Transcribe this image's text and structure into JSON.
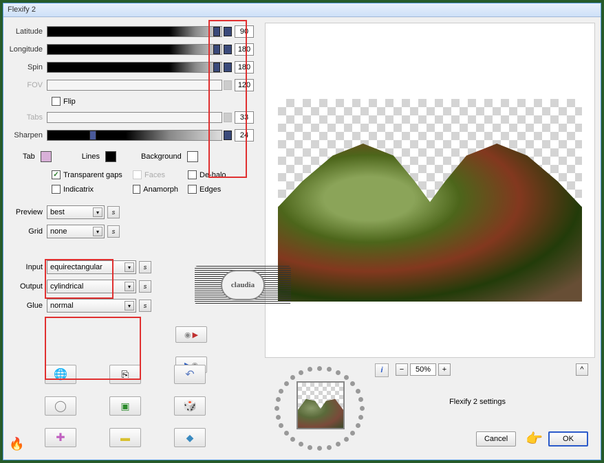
{
  "window": {
    "title": "Flexify 2"
  },
  "sliders": {
    "latitude": {
      "label": "Latitude",
      "value": "90",
      "disabled": false
    },
    "longitude": {
      "label": "Longitude",
      "value": "180",
      "disabled": false
    },
    "spin": {
      "label": "Spin",
      "value": "180",
      "disabled": false
    },
    "fov": {
      "label": "FOV",
      "value": "120",
      "disabled": true
    },
    "tabs": {
      "label": "Tabs",
      "value": "33",
      "disabled": true
    },
    "sharpen": {
      "label": "Sharpen",
      "value": "24",
      "disabled": false
    }
  },
  "flip": {
    "label": "Flip",
    "checked": false
  },
  "colors": {
    "tab": {
      "label": "Tab",
      "hex": "#d8b0d8"
    },
    "lines": {
      "label": "Lines",
      "hex": "#000000"
    },
    "background": {
      "label": "Background",
      "hex": "#ffffff"
    }
  },
  "checks": {
    "transparent_gaps": {
      "label": "Transparent gaps",
      "checked": true
    },
    "faces": {
      "label": "Faces",
      "checked": false,
      "disabled": true
    },
    "dehalo": {
      "label": "De-halo",
      "checked": false
    },
    "indicatrix": {
      "label": "Indicatrix",
      "checked": false
    },
    "anamorph": {
      "label": "Anamorph",
      "checked": false
    },
    "edges": {
      "label": "Edges",
      "checked": false
    }
  },
  "selects": {
    "preview": {
      "label": "Preview",
      "value": "best"
    },
    "grid": {
      "label": "Grid",
      "value": "none"
    },
    "input": {
      "label": "Input",
      "value": "equirectangular"
    },
    "output": {
      "label": "Output",
      "value": "cylindrical"
    },
    "glue": {
      "label": "Glue",
      "value": "normal"
    }
  },
  "watermark": "claudia",
  "zoom": {
    "value": "50%"
  },
  "settings_label": "Flexify 2 settings",
  "buttons": {
    "cancel": "Cancel",
    "ok": "OK"
  },
  "info_glyph": "i"
}
